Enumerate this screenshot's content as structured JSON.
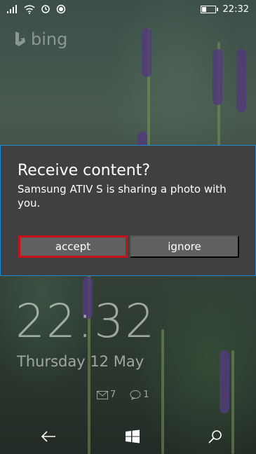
{
  "status_bar": {
    "time": "22:32",
    "icons": [
      "signal-icon",
      "wifi-icon",
      "sync-icon",
      "record-icon"
    ]
  },
  "branding": {
    "logo_text": "bing"
  },
  "dialog": {
    "title": "Receive content?",
    "message": "Samsung ATIV S is sharing a photo with you.",
    "accept_label": "accept",
    "ignore_label": "ignore",
    "border_color": "#1e8ad6",
    "focus_color": "#c8101a"
  },
  "lockscreen": {
    "time": "22:32",
    "date": "Thursday 12 May",
    "notifications": [
      {
        "icon": "mail-icon",
        "count": "7"
      },
      {
        "icon": "messaging-icon",
        "count": "1"
      }
    ]
  },
  "navbar": {
    "buttons": [
      "back-icon",
      "windows-start-icon",
      "search-icon"
    ]
  }
}
